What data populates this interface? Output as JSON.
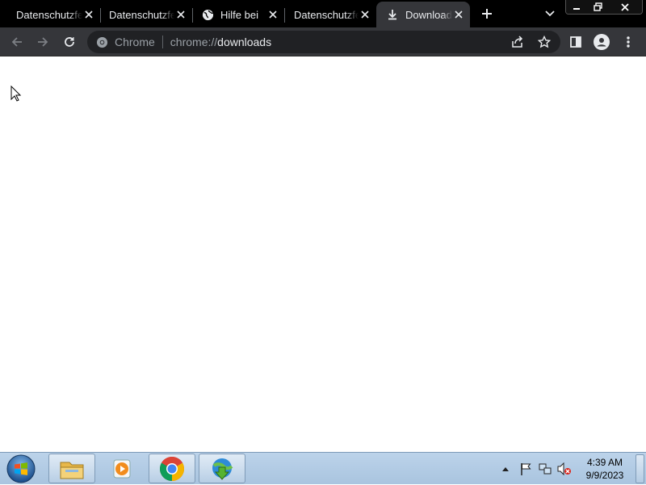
{
  "browser": {
    "tabs": [
      {
        "label": "Datenschutzfe",
        "favicon": "none",
        "active": false
      },
      {
        "label": "Datenschutzfe",
        "favicon": "none",
        "active": false
      },
      {
        "label": "Hilfe bei",
        "favicon": "globe-icon",
        "active": false
      },
      {
        "label": "Datenschutzfe",
        "favicon": "none",
        "active": false
      },
      {
        "label": "Downloads",
        "favicon": "download-icon",
        "active": true
      }
    ],
    "omnibox": {
      "chip": "Chrome",
      "url_prefix": "chrome://",
      "url_main": "downloads"
    }
  },
  "taskbar": {
    "clock_time": "4:39 AM",
    "clock_date": "9/9/2023",
    "pinned": [
      "file-explorer-icon",
      "media-player-icon",
      "chrome-icon",
      "download-manager-icon"
    ]
  },
  "colors": {
    "tabstrip": "#000000",
    "toolbar": "#35363a",
    "omnibox": "#202124",
    "text_light": "#e8eaed",
    "text_dim": "#9aa0a6",
    "taskbar": "#a9c4df"
  }
}
